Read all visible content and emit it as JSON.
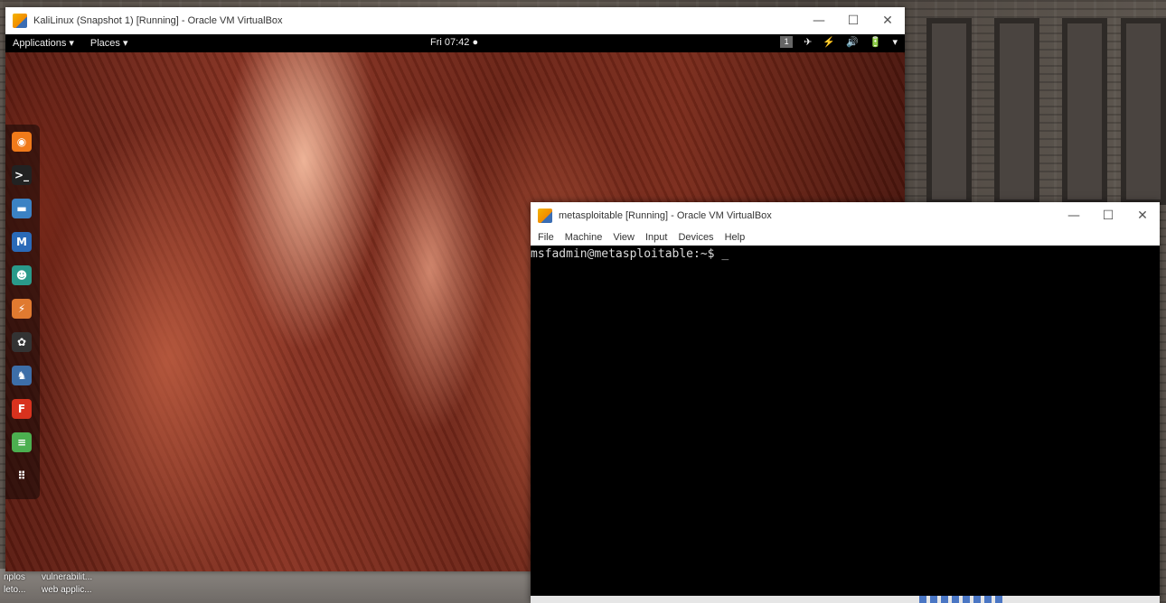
{
  "kali_window": {
    "title": "KaliLinux (Snapshot 1) [Running] - Oracle VM VirtualBox",
    "controls": {
      "minimize": "—",
      "maximize": "☐",
      "close": "✕"
    }
  },
  "gnome_topbar": {
    "applications": "Applications ▾",
    "places": "Places ▾",
    "clock": "Fri 07:42 ●",
    "workspace": "1",
    "tray_icons": [
      "✈",
      "⚡",
      "🔊",
      "🔋",
      "▾"
    ]
  },
  "dock": {
    "items": [
      {
        "name": "firefox-icon",
        "glyph": "◉",
        "color": "#f07a1a"
      },
      {
        "name": "terminal-icon",
        "glyph": ">_",
        "color": "#222"
      },
      {
        "name": "files-icon",
        "glyph": "▬",
        "color": "#3b82c4"
      },
      {
        "name": "metasploit-icon",
        "glyph": "M",
        "color": "#2a6ab8"
      },
      {
        "name": "armitage-icon",
        "glyph": "☻",
        "color": "#2a9a8a"
      },
      {
        "name": "burpsuite-icon",
        "glyph": "⚡",
        "color": "#e07a30"
      },
      {
        "name": "maltego-icon",
        "glyph": "✿",
        "color": "#333"
      },
      {
        "name": "beef-icon",
        "glyph": "♞",
        "color": "#3d6ea8"
      },
      {
        "name": "faraday-icon",
        "glyph": "F",
        "color": "#d8321e"
      },
      {
        "name": "notes-icon",
        "glyph": "≡",
        "color": "#4caf50"
      },
      {
        "name": "show-apps-icon",
        "glyph": "⠿",
        "color": "transparent"
      }
    ]
  },
  "desktop_labels": {
    "row1_a": "nplos",
    "row1_b": "vulnerabilit...",
    "row2_a": "leto...",
    "row2_b": "web applic..."
  },
  "msf_window": {
    "title": "metasploitable [Running] - Oracle VM VirtualBox",
    "menu": [
      "File",
      "Machine",
      "View",
      "Input",
      "Devices",
      "Help"
    ],
    "prompt": "msfadmin@metasploitable:~$ _"
  }
}
